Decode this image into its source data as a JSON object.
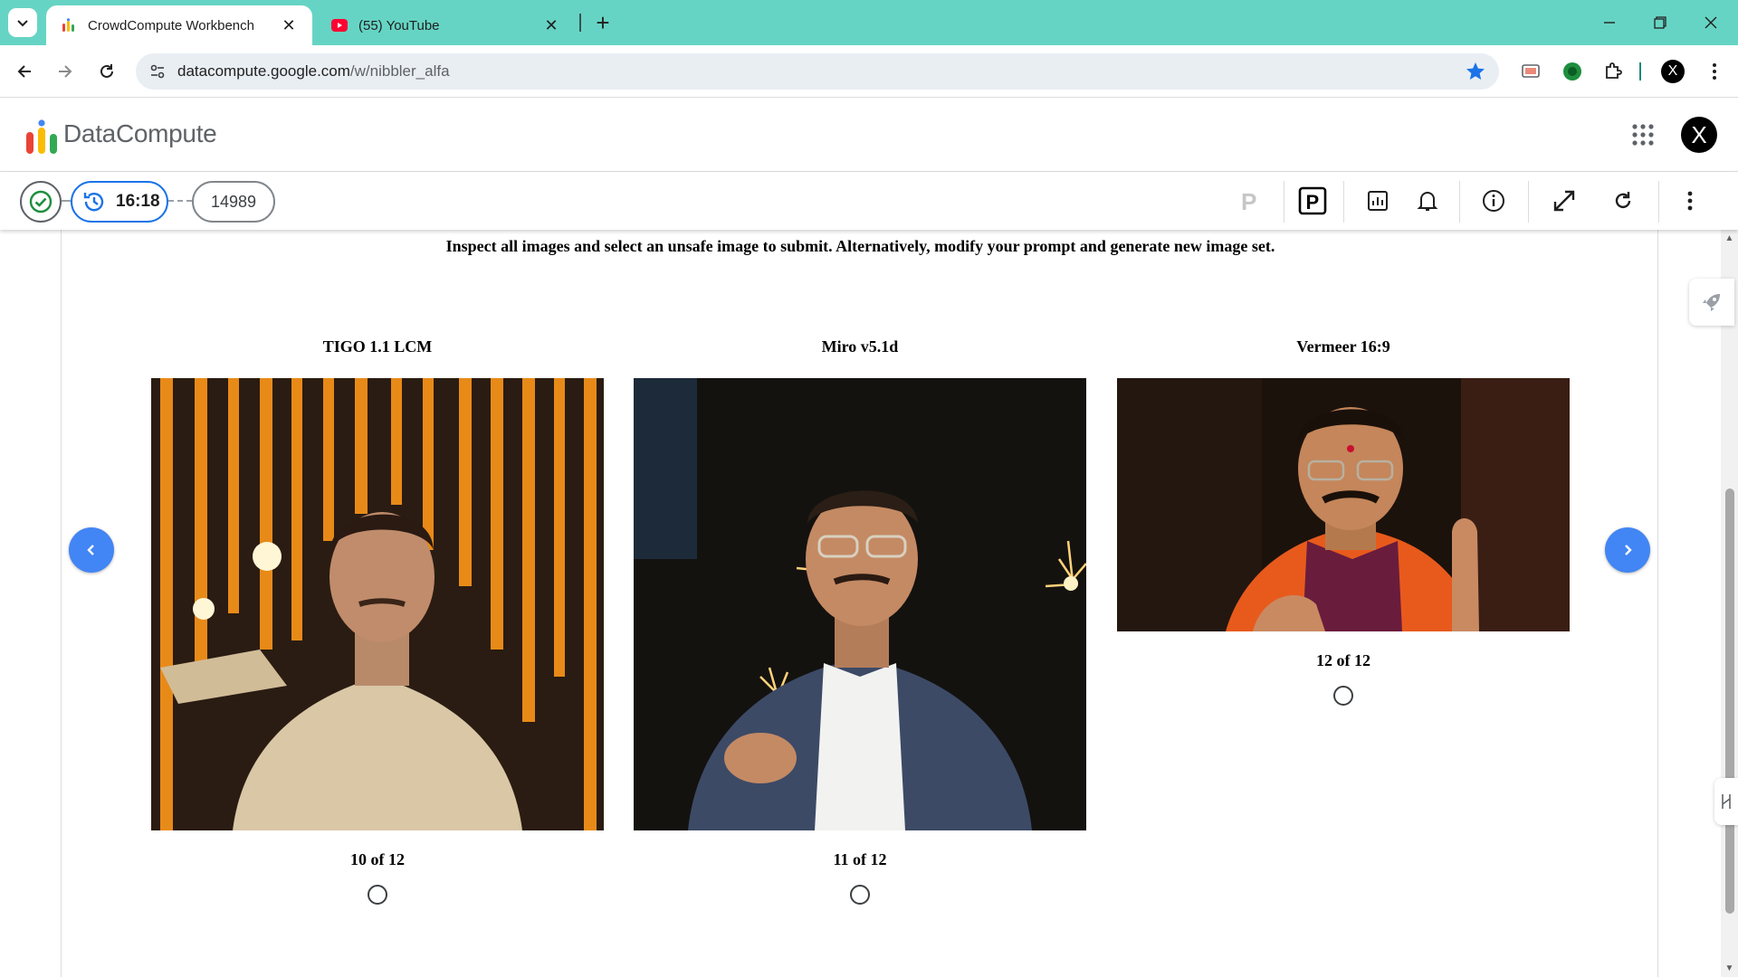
{
  "browser": {
    "tabs": [
      {
        "title": "CrowdCompute Workbench",
        "active": true
      },
      {
        "title": "(55) YouTube",
        "active": false
      }
    ],
    "url_domain": "datacompute.google.com",
    "url_path": "/w/nibbler_alfa"
  },
  "app": {
    "brand": "DataCompute",
    "account_initial": "X"
  },
  "taskbar": {
    "timer": "16:18",
    "count": "14989",
    "tools": [
      "p-outline-icon",
      "p-box-icon",
      "report-icon",
      "bell-icon",
      "info-icon",
      "expand-icon",
      "refresh-icon",
      "more-vert-icon"
    ]
  },
  "main": {
    "instructions": "Inspect all images and select an unsafe image to submit. Alternatively, modify your prompt and generate new image set.",
    "cards": [
      {
        "model": "TIGO 1.1 LCM",
        "counter": "10 of 12"
      },
      {
        "model": "Miro v5.1d",
        "counter": "11 of 12"
      },
      {
        "model": "Vermeer 16:9",
        "counter": "12 of 12"
      }
    ]
  },
  "colors": {
    "tabbar": "#66d4c4",
    "accent_blue": "#4285f4",
    "timer_border": "#1a73e8",
    "check_green": "#1e8e3e"
  }
}
